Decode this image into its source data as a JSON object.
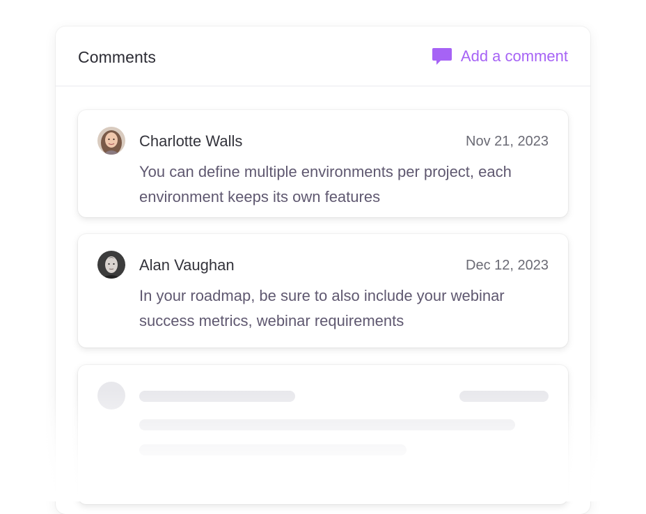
{
  "header": {
    "title": "Comments",
    "add_label": "Add a comment",
    "add_icon": "chat-bubble-icon",
    "accent_color": "#a663f5"
  },
  "comments": [
    {
      "author": "Charlotte Walls",
      "date": "Nov 21, 2023",
      "text": "You can define multiple environments per project, each environment keeps its own features",
      "avatar_icon": "avatar-photo"
    },
    {
      "author": "Alan Vaughan",
      "date": "Dec 12, 2023",
      "text": "In your roadmap, be sure to also include your webinar success metrics, webinar requirements",
      "avatar_icon": "avatar-photo"
    }
  ],
  "colors": {
    "title": "#2b2b33",
    "author": "#33333b",
    "date": "#6a6a74",
    "body": "#5f5870",
    "skeleton": "#e8e8ec"
  }
}
